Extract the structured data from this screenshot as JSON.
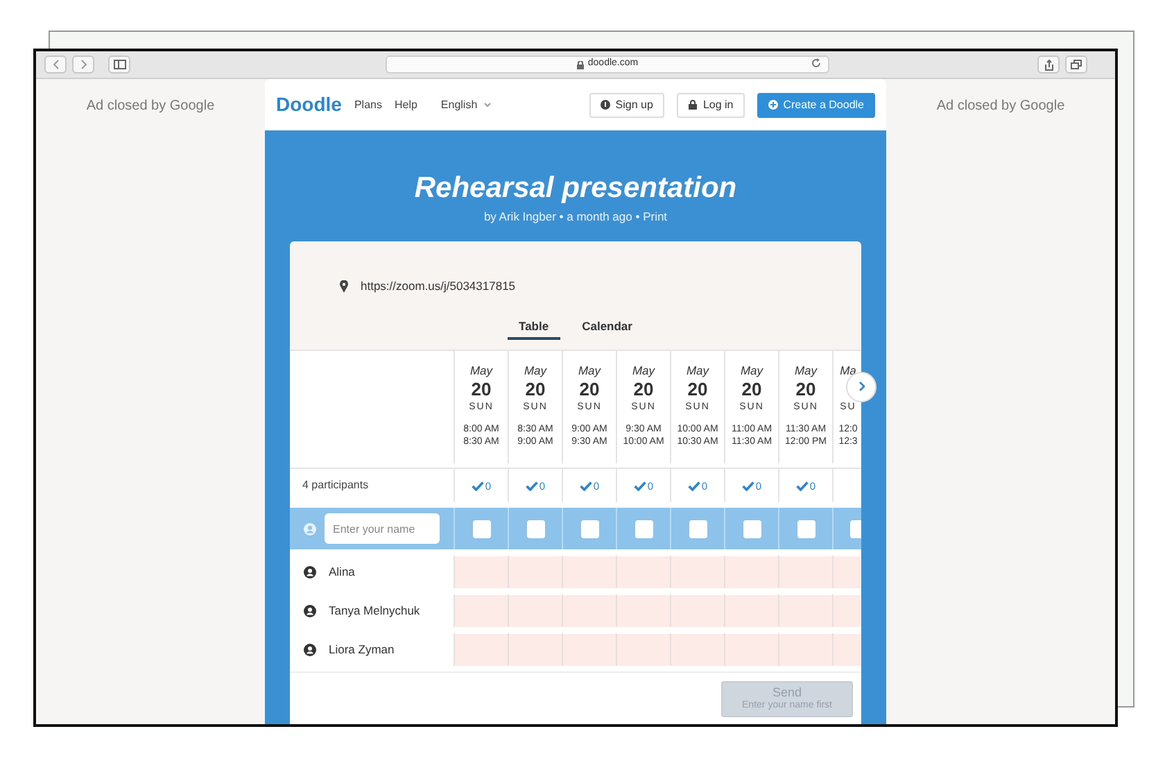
{
  "browser": {
    "address": "doodle.com"
  },
  "ads": [
    "Ad closed by Google",
    "Ad closed by Google"
  ],
  "header": {
    "logo": "Doodle",
    "links": [
      "Plans",
      "Help"
    ],
    "language": "English",
    "buttons": [
      {
        "kind": "signup",
        "label": "Sign up"
      },
      {
        "kind": "login",
        "label": "Log in"
      },
      {
        "kind": "create",
        "label": "Create a Doodle"
      }
    ]
  },
  "poll": {
    "title": "Rehearsal presentation",
    "byline": "by Arik Ingber • a month ago • Print",
    "location": "https://zoom.us/j/5034317815"
  },
  "tabs": [
    {
      "label": "Table",
      "selected": true
    },
    {
      "label": "Calendar",
      "selected": false
    }
  ],
  "options": [
    {
      "month": "May",
      "day": "20",
      "weekday": "SUN",
      "start": "8:00 AM",
      "end": "8:30 AM",
      "count": "0"
    },
    {
      "month": "May",
      "day": "20",
      "weekday": "SUN",
      "start": "8:30 AM",
      "end": "9:00 AM",
      "count": "0"
    },
    {
      "month": "May",
      "day": "20",
      "weekday": "SUN",
      "start": "9:00 AM",
      "end": "9:30 AM",
      "count": "0"
    },
    {
      "month": "May",
      "day": "20",
      "weekday": "SUN",
      "start": "9:30 AM",
      "end": "10:00 AM",
      "count": "0"
    },
    {
      "month": "May",
      "day": "20",
      "weekday": "SUN",
      "start": "10:00 AM",
      "end": "10:30 AM",
      "count": "0"
    },
    {
      "month": "May",
      "day": "20",
      "weekday": "SUN",
      "start": "11:00 AM",
      "end": "11:30 AM",
      "count": "0"
    },
    {
      "month": "May",
      "day": "20",
      "weekday": "SUN",
      "start": "11:30 AM",
      "end": "12:00 PM",
      "count": "0"
    },
    {
      "month": "Ma",
      "weekday": "SU",
      "start": "12:0",
      "end": "12:3"
    }
  ],
  "participant_count": "4 participants",
  "new_entry": {
    "placeholder": "Enter your name",
    "checks": [
      false,
      false,
      false,
      false,
      false,
      false,
      false,
      false
    ]
  },
  "participants": [
    "Alina",
    "Tanya Melnychuk",
    "Liora Zyman"
  ],
  "send": {
    "label": "Send",
    "hint": "Enter your name first",
    "disabled": true
  }
}
